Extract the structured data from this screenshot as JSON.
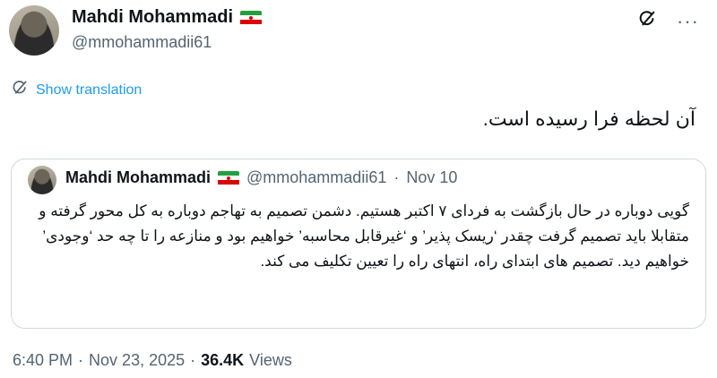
{
  "author": {
    "display_name": "Mahdi Mohammadi",
    "handle": "@mmohammadii61",
    "flag_icon": "iran-flag-icon"
  },
  "actions": {
    "grok_icon": "grok-icon",
    "more_icon": "more-icon",
    "more_glyph": "···"
  },
  "translation": {
    "label": "Show translation"
  },
  "tweet": {
    "text": "آن لحظه فرا رسیده است."
  },
  "quoted": {
    "display_name": "Mahdi Mohammadi",
    "handle": "@mmohammadii61",
    "separator": "·",
    "date": "Nov 10",
    "body": "گویی دوباره در حال بازگشت به فردای ۷ اکتبر هستیم. دشمن تصمیم به تهاجم دوباره به کل محور گرفته و متقابلا باید تصمیم گرفت چقدر ‘ریسک پذیر’ و ‘غیرقابل محاسبه’ خواهیم بود و منازعه را تا چه حد ‘وجودی’ خواهیم دید. تصمیم های ابتدای راه، انتهای راه را تعیین تکلیف می کند."
  },
  "meta": {
    "time": "6:40 PM",
    "sep1": "·",
    "date": "Nov 23, 2025",
    "sep2": "·",
    "views_count": "36.4K",
    "views_label": "Views"
  },
  "colors": {
    "link": "#1d9bf0",
    "secondary_text": "#536471",
    "border": "#cfd9de"
  }
}
